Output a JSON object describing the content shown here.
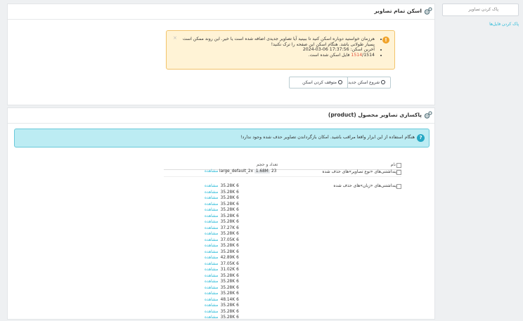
{
  "sidebar": {
    "search_text": "پاک کردن تصاویر",
    "link": "پاک کردن فایل‌ها"
  },
  "scan": {
    "title": "اسکن تمام تصاویر",
    "warning": {
      "line1": "هرزمان خواستید دوباره اسکن کنید تا ببینید آیا تصاویر جدیدی اضافه شده است یا خیر. این روند ممکن است بسیار طولانی باشد. هنگام اسکن این صفحه را ترک نکنید!",
      "last_scan_label": "آخرین اسکن:",
      "last_scan_value": "2024-03-06 17:37:56",
      "scanned_count": "1514",
      "total_count": "1514",
      "scanned_suffix": "فایل اسکن شده است."
    },
    "start_button": "شروع اسکن جدید",
    "stop_button": "متوقف کردن اسکن"
  },
  "cleanup": {
    "title": "پاکسازی تصاویر محصول (product)",
    "info_text": "هنگام استفاده از این ابزار واقعا مراقب باشید. امکان بازگرداندن تصاویر حذف شده وجود ندارد!",
    "col_name": "نام",
    "col_count_size": "تعداد و حجم",
    "category1": "پنداشتنی‌های «نوع تصاویر»‌های حذف شده",
    "category2": "پنداشتنی‌های «زبان»‌های حذف شده",
    "cat1_item": {
      "count": "23",
      "name": "large_default_2x",
      "size": "1.68M",
      "view": "مشاهده"
    },
    "view_label": "مشاهده",
    "items": [
      {
        "count": "6",
        "size": "35.28K"
      },
      {
        "count": "6",
        "size": "35.28K"
      },
      {
        "count": "6",
        "size": "35.28K"
      },
      {
        "count": "6",
        "size": "35.28K"
      },
      {
        "count": "6",
        "size": "35.28K"
      },
      {
        "count": "6",
        "size": "35.28K"
      },
      {
        "count": "6",
        "size": "35.28K"
      },
      {
        "count": "6",
        "size": "37.27K"
      },
      {
        "count": "6",
        "size": "35.28K"
      },
      {
        "count": "6",
        "size": "37.05K"
      },
      {
        "count": "6",
        "size": "35.28K"
      },
      {
        "count": "6",
        "size": "35.28K"
      },
      {
        "count": "6",
        "size": "42.89K"
      },
      {
        "count": "6",
        "size": "37.05K"
      },
      {
        "count": "6",
        "size": "31.02K"
      },
      {
        "count": "6",
        "size": "35.28K"
      },
      {
        "count": "6",
        "size": "35.28K"
      },
      {
        "count": "6",
        "size": "35.28K"
      },
      {
        "count": "6",
        "size": "35.28K"
      },
      {
        "count": "6",
        "size": "48.14K"
      },
      {
        "count": "6",
        "size": "35.28K"
      },
      {
        "count": "6",
        "size": "35.28K"
      },
      {
        "count": "6",
        "size": "35.28K"
      }
    ]
  }
}
